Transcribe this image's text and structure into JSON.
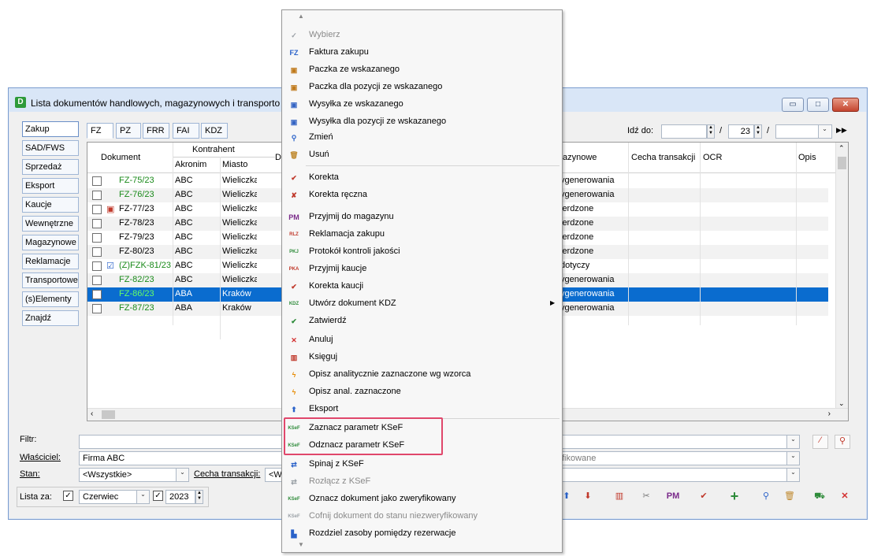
{
  "window": {
    "title": "Lista dokumentów handlowych, magazynowych i transporto",
    "app_icon": "D",
    "min_label": "▭",
    "max_label": "□",
    "close_label": "✕"
  },
  "left_tabs": [
    "Zakup",
    "SAD/FWS",
    "Sprzedaż",
    "Eksport",
    "Kaucje",
    "Wewnętrzne",
    "Magazynowe",
    "Reklamacje",
    "Transportowe",
    "(s)Elementy",
    "Znajdź"
  ],
  "doc_tabs": [
    "FZ",
    "PZ",
    "FRR",
    "FAI",
    "KDZ"
  ],
  "goto": {
    "label": "Idź do:",
    "value1": "",
    "slash1": "/",
    "value2": "23",
    "slash2": "/",
    "value3": ""
  },
  "grid": {
    "headers": {
      "dokument": "Dokument",
      "kontrahent": "Kontrahent",
      "akronim": "Akronim",
      "miasto": "Miasto",
      "da": "Da",
      "magazynowe": "azynowe",
      "cecha": "Cecha transakcji",
      "ocr": "OCR",
      "opis": "Opis"
    },
    "rows": [
      {
        "doc": "FZ-75/23",
        "akronim": "ABC",
        "miasto": "Wieliczka",
        "status": "ygenerowania",
        "icon": ""
      },
      {
        "doc": "FZ-76/23",
        "akronim": "ABC",
        "miasto": "Wieliczka",
        "status": "ygenerowania",
        "icon": ""
      },
      {
        "doc": "FZ-77/23",
        "akronim": "ABC",
        "miasto": "Wieliczka",
        "status": "ierdzone",
        "icon": "doc"
      },
      {
        "doc": "FZ-78/23",
        "akronim": "ABC",
        "miasto": "Wieliczka",
        "status": "ierdzone",
        "icon": ""
      },
      {
        "doc": "FZ-79/23",
        "akronim": "ABC",
        "miasto": "Wieliczka",
        "status": "ierdzone",
        "icon": ""
      },
      {
        "doc": "FZ-80/23",
        "akronim": "ABC",
        "miasto": "Wieliczka",
        "status": "ierdzone",
        "icon": ""
      },
      {
        "doc": "(Z)FZK-81/23",
        "akronim": "ABC",
        "miasto": "Wieliczka",
        "status": "dotyczy",
        "icon": "check"
      },
      {
        "doc": "FZ-82/23",
        "akronim": "ABC",
        "miasto": "Wieliczka",
        "status": "ygenerowania",
        "icon": ""
      },
      {
        "doc": "FZ-86/23",
        "akronim": "ABA",
        "miasto": "Kraków",
        "status": "ygenerowania",
        "icon": ""
      },
      {
        "doc": "FZ-87/23",
        "akronim": "ABA",
        "miasto": "Kraków",
        "status": "ygenerowania",
        "icon": ""
      }
    ],
    "green_rows": [
      0,
      1,
      6,
      7,
      8,
      9
    ],
    "selected_row": 8
  },
  "filters": {
    "filtr_label": "Filtr:",
    "wlasciciel_label": "Właściciel:",
    "wlasciciel_value": "Firma ABC",
    "wlasciciel_right": "fikowane",
    "stan_label": "Stan:",
    "stan_value": "<Wszystkie>",
    "cecha_label": "Cecha transakcji:",
    "cecha_value": "<W",
    "lista_za_label": "Lista za:",
    "month": "Czerwiec",
    "year": "2023"
  },
  "menu": {
    "items": [
      {
        "label": "Wybierz",
        "icon": "check-icon",
        "glyph": "✓",
        "color": "#9aa0a6",
        "disabled": true
      },
      {
        "label": "Faktura zakupu",
        "icon": "fz-icon",
        "glyph": "FZ",
        "color": "#2a62c9",
        "disabled": false
      },
      {
        "label": "Paczka ze wskazanego",
        "icon": "package-icon",
        "glyph": "▣",
        "color": "#c07a1c",
        "disabled": false
      },
      {
        "label": "Paczka dla pozycji ze wskazanego",
        "icon": "package-icon",
        "glyph": "▣",
        "color": "#c07a1c",
        "disabled": false
      },
      {
        "label": "Wysyłka ze wskazanego",
        "icon": "shipment-icon",
        "glyph": "▣",
        "color": "#3565c4",
        "disabled": false
      },
      {
        "label": "Wysyłka dla pozycji ze wskazanego",
        "icon": "shipment-icon",
        "glyph": "▣",
        "color": "#3565c4",
        "disabled": false
      },
      {
        "label": "Zmień",
        "icon": "magnifier-icon",
        "glyph": "⚲",
        "color": "#2a62c9",
        "disabled": false
      },
      {
        "label": "Usuń",
        "icon": "trash-icon",
        "glyph": "🗑",
        "color": "#c08a30",
        "disabled": false
      },
      {
        "label": "Korekta",
        "icon": "correction-icon",
        "glyph": "✔",
        "color": "#c0392b",
        "disabled": false
      },
      {
        "label": "Korekta ręczna",
        "icon": "manual-correction-icon",
        "glyph": "✘",
        "color": "#c0392b",
        "disabled": false
      },
      {
        "label": "Przyjmij do magazynu",
        "icon": "pm-icon",
        "glyph": "PM",
        "color": "#7a2a8a",
        "disabled": false
      },
      {
        "label": "Reklamacja zakupu",
        "icon": "rlz-icon",
        "glyph": "RLZ",
        "color": "#c0392b",
        "disabled": false
      },
      {
        "label": "Protokół kontroli jakości",
        "icon": "pkj-icon",
        "glyph": "PKJ",
        "color": "#2e8b3a",
        "disabled": false
      },
      {
        "label": "Przyjmij kaucje",
        "icon": "pka-icon",
        "glyph": "PKA",
        "color": "#c0392b",
        "disabled": false
      },
      {
        "label": "Korekta kaucji",
        "icon": "deposit-correction-icon",
        "glyph": "✔",
        "color": "#c0392b",
        "disabled": false
      },
      {
        "label": "Utwórz dokument KDZ",
        "icon": "kdz-icon",
        "glyph": "KDZ",
        "color": "#2e8b3a",
        "disabled": false,
        "submenu": "▶"
      },
      {
        "label": "Zatwierdź",
        "icon": "approve-icon",
        "glyph": "✔",
        "color": "#2e8b3a",
        "disabled": false
      },
      {
        "label": "Anuluj",
        "icon": "cancel-icon",
        "glyph": "✕",
        "color": "#d32f2f",
        "disabled": false
      },
      {
        "label": "Księguj",
        "icon": "post-icon",
        "glyph": "▥",
        "color": "#c0392b",
        "disabled": false
      },
      {
        "label": "Opisz analitycznie zaznaczone wg wzorca",
        "icon": "analytics-icon",
        "glyph": "ϟ",
        "color": "#e68a00",
        "disabled": false
      },
      {
        "label": "Opisz anal. zaznaczone",
        "icon": "analytics-icon",
        "glyph": "ϟ",
        "color": "#e68a00",
        "disabled": false
      },
      {
        "label": "Eksport",
        "icon": "export-icon",
        "glyph": "⬆",
        "color": "#2a62c9",
        "disabled": false
      },
      {
        "label": "Zaznacz parametr KSeF",
        "icon": "ksef-check-icon",
        "glyph": "KSeF",
        "color": "#2e8b3a",
        "disabled": false
      },
      {
        "label": "Odznacz parametr KSeF",
        "icon": "ksef-uncheck-icon",
        "glyph": "KSeF",
        "color": "#2e8b3a",
        "disabled": false
      },
      {
        "label": "Spinaj z KSeF",
        "icon": "link-icon",
        "glyph": "⇄",
        "color": "#2a62c9",
        "disabled": false
      },
      {
        "label": "Rozłącz z KSeF",
        "icon": "unlink-icon",
        "glyph": "⇄",
        "color": "#9aa0a6",
        "disabled": true
      },
      {
        "label": "Oznacz dokument jako zweryfikowany",
        "icon": "ksef-verify-icon",
        "glyph": "KSeF",
        "color": "#2e8b3a",
        "disabled": false
      },
      {
        "label": "Cofnij dokument do stanu niezweryfikowany",
        "icon": "ksef-unverify-icon",
        "glyph": "KSeF",
        "color": "#9aa0a6",
        "disabled": true
      },
      {
        "label": "Rozdziel zasoby pomiędzy rezerwacje",
        "icon": "resources-icon",
        "glyph": "▙",
        "color": "#2a62c9",
        "disabled": false
      }
    ],
    "scroll_up": "▲",
    "scroll_down": "▼"
  },
  "toolbar": {
    "pm_label": "PM"
  }
}
